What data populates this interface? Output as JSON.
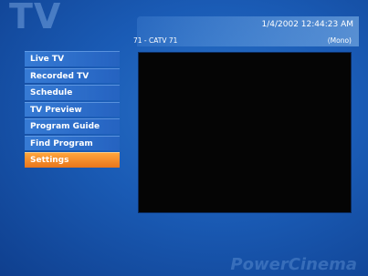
{
  "header": {
    "corner_title": "TV",
    "timestamp": "1/4/2002 12:44:23 AM",
    "channel": "71 - CATV 71",
    "audio_mode": "(Mono)"
  },
  "menu": {
    "items": [
      {
        "label": "Live TV"
      },
      {
        "label": "Recorded TV"
      },
      {
        "label": "Schedule"
      },
      {
        "label": "TV Preview"
      },
      {
        "label": "Program Guide"
      },
      {
        "label": "Find Program"
      },
      {
        "label": "Settings"
      }
    ],
    "active_index": 6
  },
  "brand": {
    "logo_text": "PowerCinema"
  },
  "colors": {
    "background": "#1a5bb5",
    "menu_item": "#3c82dc",
    "active_item": "#f5901f",
    "video": "#050505"
  }
}
